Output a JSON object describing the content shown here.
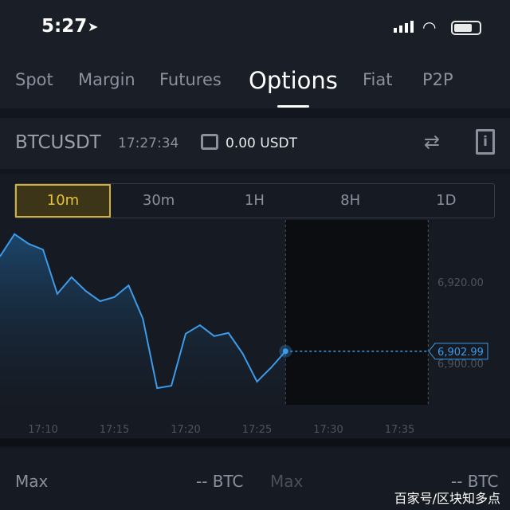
{
  "status_bar": {
    "time": "5:27",
    "location_icon": "location-arrow-icon",
    "wifi_icon": "wifi-icon",
    "battery_icon": "battery-icon"
  },
  "tabs": [
    {
      "label": "Spot"
    },
    {
      "label": "Margin"
    },
    {
      "label": "Futures"
    },
    {
      "label": "Options",
      "active": true
    },
    {
      "label": "Fiat"
    },
    {
      "label": "P2P"
    }
  ],
  "header": {
    "symbol": "BTCUSDT",
    "time": "17:27:34",
    "balance": "0.00 USDT",
    "swap_icon": "swap-icon",
    "info_icon": "info-document-icon"
  },
  "ranges": [
    {
      "label": "10m",
      "active": true
    },
    {
      "label": "30m"
    },
    {
      "label": "1H"
    },
    {
      "label": "8H"
    },
    {
      "label": "1D"
    }
  ],
  "colors": {
    "line": "#3d9be9",
    "accent": "#e6c23b",
    "background": "#161a22"
  },
  "chart_data": {
    "type": "area",
    "x": [
      "17:07",
      "17:08",
      "17:09",
      "17:10",
      "17:11",
      "17:12",
      "17:13",
      "17:14",
      "17:15",
      "17:16",
      "17:17",
      "17:18",
      "17:19",
      "17:20",
      "17:21",
      "17:22",
      "17:23",
      "17:24",
      "17:25",
      "17:26",
      "17:27"
    ],
    "values": [
      6926.3,
      6931.8,
      6929.4,
      6928.0,
      6917.1,
      6921.2,
      6917.8,
      6915.3,
      6916.3,
      6919.2,
      6911.0,
      6893.9,
      6894.5,
      6907.3,
      6909.4,
      6906.7,
      6907.5,
      6902.4,
      6895.5,
      6899.0,
      6902.99
    ],
    "x_ticks": [
      "17:10",
      "17:15",
      "17:20",
      "17:25",
      "17:30",
      "17:35"
    ],
    "y_ticks": [
      "6,920.00",
      "6,900.00"
    ],
    "y_tick_values": [
      6920,
      6900
    ],
    "current_price": "6,902.99",
    "xlim": [
      "17:07",
      "17:38"
    ],
    "ylim": [
      6888,
      6933
    ],
    "future_window": [
      "17:27",
      "17:37"
    ],
    "grid": false
  },
  "bottom": {
    "left_label": "Max",
    "left_value": "-- BTC",
    "right_label": "Max",
    "right_value": "-- BTC"
  },
  "watermark": "百家号/区块知多点"
}
